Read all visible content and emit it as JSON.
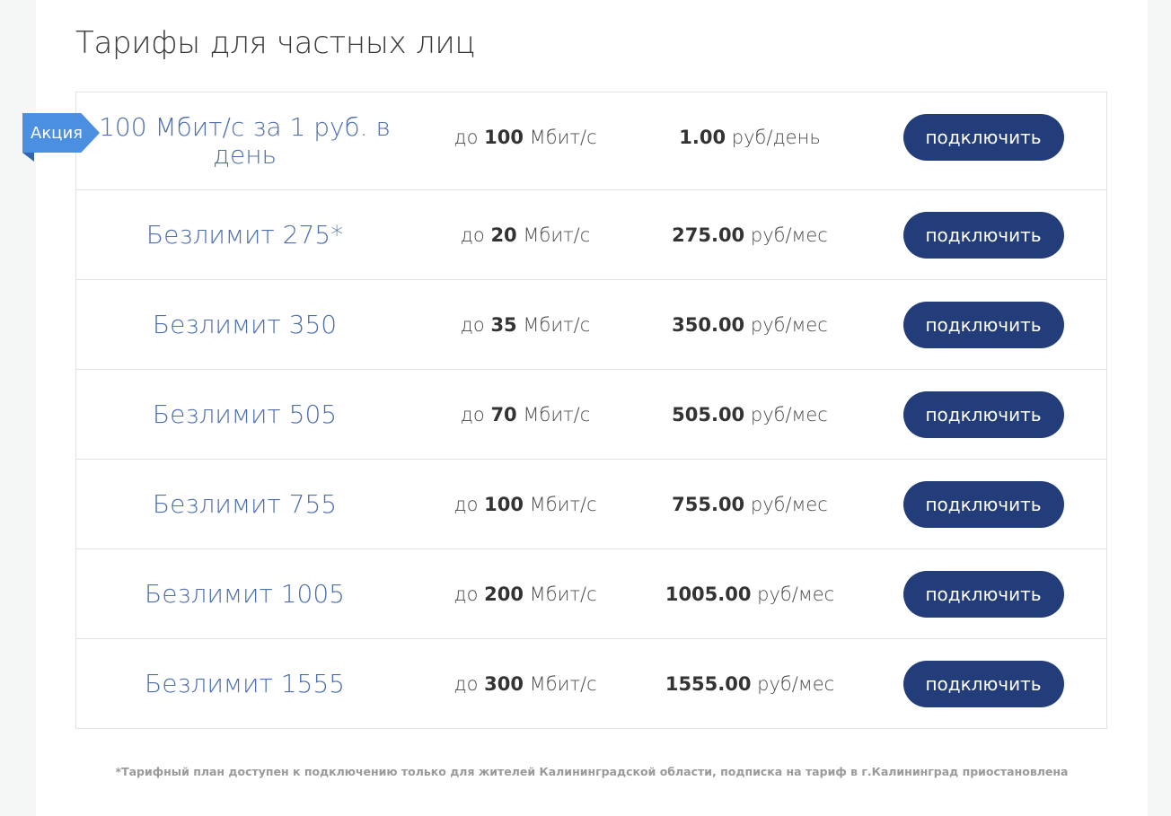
{
  "page": {
    "title": "Тарифы для частных лиц",
    "promo_badge": "Акция",
    "footnote": "*Тарифный план доступен к подключению только для жителей Калининградской области, подписка на тариф в г.Калининград приостановлена"
  },
  "tariffs": [
    {
      "name": "100 Мбит/с за 1 руб. в день",
      "speed_prefix": "до",
      "speed_value": "100",
      "speed_unit": "Мбит/с",
      "price_value": "1.00",
      "price_unit": "руб/день",
      "button": "подключить"
    },
    {
      "name": "Безлимит 275*",
      "speed_prefix": "до",
      "speed_value": "20",
      "speed_unit": "Мбит/с",
      "price_value": "275.00",
      "price_unit": "руб/мес",
      "button": "подключить"
    },
    {
      "name": "Безлимит 350",
      "speed_prefix": "до",
      "speed_value": "35",
      "speed_unit": "Мбит/с",
      "price_value": "350.00",
      "price_unit": "руб/мес",
      "button": "подключить"
    },
    {
      "name": "Безлимит 505",
      "speed_prefix": "до",
      "speed_value": "70",
      "speed_unit": "Мбит/с",
      "price_value": "505.00",
      "price_unit": "руб/мес",
      "button": "подключить"
    },
    {
      "name": "Безлимит 755",
      "speed_prefix": "до",
      "speed_value": "100",
      "speed_unit": "Мбит/с",
      "price_value": "755.00",
      "price_unit": "руб/мес",
      "button": "подключить"
    },
    {
      "name": "Безлимит 1005",
      "speed_prefix": "до",
      "speed_value": "200",
      "speed_unit": "Мбит/с",
      "price_value": "1005.00",
      "price_unit": "руб/мес",
      "button": "подключить"
    },
    {
      "name": "Безлимит 1555",
      "speed_prefix": "до",
      "speed_value": "300",
      "speed_unit": "Мбит/с",
      "price_value": "1555.00",
      "price_unit": "руб/мес",
      "button": "подключить"
    }
  ],
  "colors": {
    "accent": "#233d7a",
    "tariff_name": "#4d6fb0",
    "promo_badge": "#4b8fe0"
  }
}
